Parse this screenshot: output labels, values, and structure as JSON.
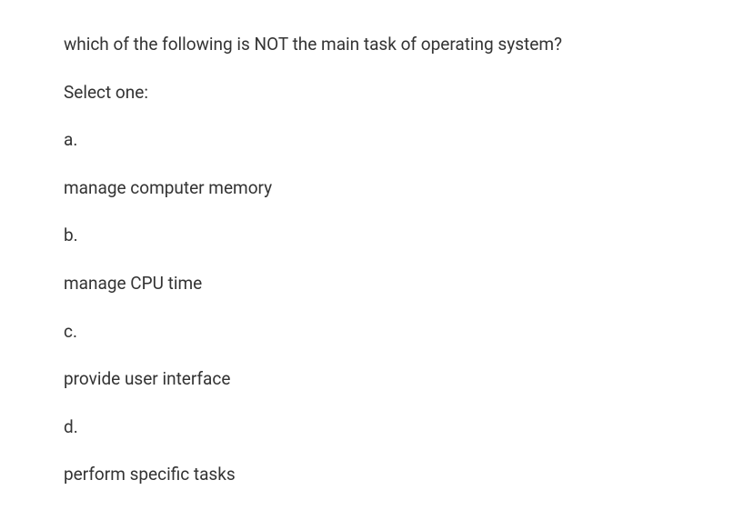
{
  "question": {
    "text": "which of the following is NOT the main task of operating system?",
    "select_prompt": "Select one:",
    "options": [
      {
        "letter": "a.",
        "text": "manage computer memory"
      },
      {
        "letter": "b.",
        "text": "manage CPU time"
      },
      {
        "letter": "c.",
        "text": "provide user interface"
      },
      {
        "letter": "d.",
        "text": "perform specific tasks"
      }
    ]
  }
}
